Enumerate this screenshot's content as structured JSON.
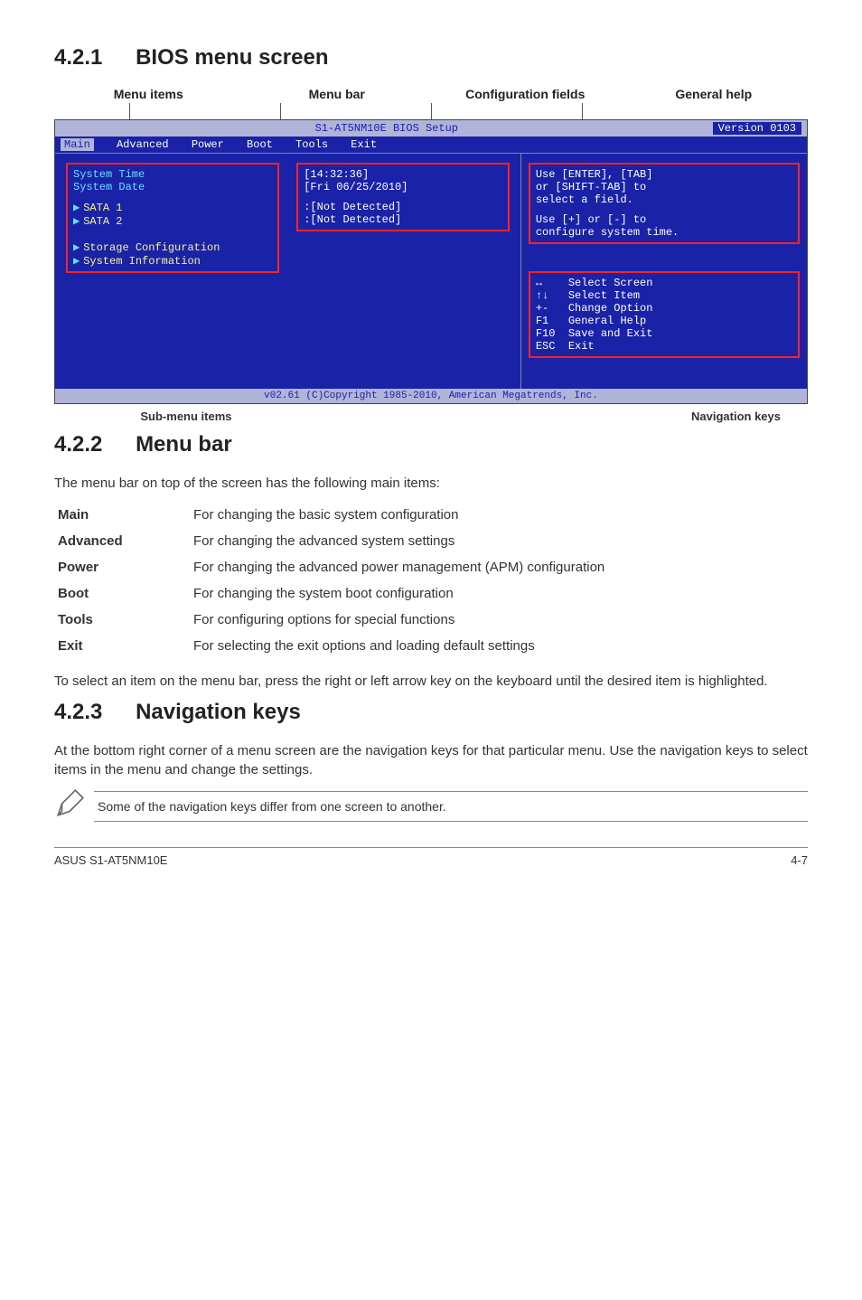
{
  "sec1": {
    "num": "4.2.1",
    "title": "BIOS menu screen"
  },
  "topLabels": [
    "Menu items",
    "Menu bar",
    "Configuration fields",
    "General help"
  ],
  "bios": {
    "titleLeft": "S1-AT5NM10E BIOS Setup",
    "titleRight": "Version 0103",
    "menu": {
      "main": "Main",
      "adv": "Advanced",
      "power": "Power",
      "boot": "Boot",
      "tools": "Tools",
      "exit": "Exit"
    },
    "fields": {
      "systime": {
        "label": "System Time",
        "val": "[14:32:36]"
      },
      "sysdate": {
        "label": "System Date",
        "val": "[Fri 06/25/2010]"
      },
      "sata1": {
        "label": "SATA 1",
        "val": ":[Not Detected]"
      },
      "sata2": {
        "label": "SATA 2",
        "val": ":[Not Detected]"
      },
      "storage": "Storage Configuration",
      "sysinfo": "System Information"
    },
    "help": {
      "l1": "Use [ENTER], [TAB]",
      "l2": "or [SHIFT-TAB] to",
      "l3": "select a field.",
      "l4": "Use [+] or [-] to",
      "l5": "configure system time."
    },
    "nav": [
      {
        "k": "↔",
        "t": "Select Screen"
      },
      {
        "k": "↑↓",
        "t": "Select Item"
      },
      {
        "k": "+-",
        "t": "Change Option"
      },
      {
        "k": "F1",
        "t": "General Help"
      },
      {
        "k": "F10",
        "t": "Save and Exit"
      },
      {
        "k": "ESC",
        "t": "Exit"
      }
    ],
    "footer": "v02.61 (C)Copyright 1985-2010, American Megatrends, Inc."
  },
  "belowLabels": {
    "a": "Sub-menu items",
    "b": "Navigation keys"
  },
  "sec2": {
    "num": "4.2.2",
    "title": "Menu bar"
  },
  "sec2intro": "The menu bar on top of the screen has the following main items:",
  "defs": [
    {
      "k": "Main",
      "v": "For changing the basic system configuration"
    },
    {
      "k": "Advanced",
      "v": "For changing the advanced system settings"
    },
    {
      "k": "Power",
      "v": "For changing the advanced power management (APM) configuration"
    },
    {
      "k": "Boot",
      "v": "For changing the system boot configuration"
    },
    {
      "k": "Tools",
      "v": "For configuring options for special functions"
    },
    {
      "k": "Exit",
      "v": "For selecting the exit options and loading default settings"
    }
  ],
  "sec2para": "To select an item on the menu bar, press the right or left arrow key on the keyboard until the desired item is highlighted.",
  "sec3": {
    "num": "4.2.3",
    "title": "Navigation keys"
  },
  "sec3para": "At the bottom right corner of a menu screen are the navigation keys for that particular menu. Use the navigation keys to select items in the menu and change the settings.",
  "note": "Some of the navigation keys differ from one screen to another.",
  "footer": {
    "left": "ASUS S1-AT5NM10E",
    "right": "4-7"
  },
  "chart_data": {
    "type": "table",
    "title": "S1-AT5NM10E BIOS Setup — Main",
    "fields": [
      {
        "name": "System Time",
        "value": "[14:32:36]"
      },
      {
        "name": "System Date",
        "value": "[Fri 06/25/2010]"
      },
      {
        "name": "SATA 1",
        "value": "[Not Detected]"
      },
      {
        "name": "SATA 2",
        "value": "[Not Detected]"
      }
    ],
    "submenus": [
      "Storage Configuration",
      "System Information"
    ],
    "version": "0103",
    "copyright": "v02.61 (C)Copyright 1985-2010, American Megatrends, Inc."
  }
}
